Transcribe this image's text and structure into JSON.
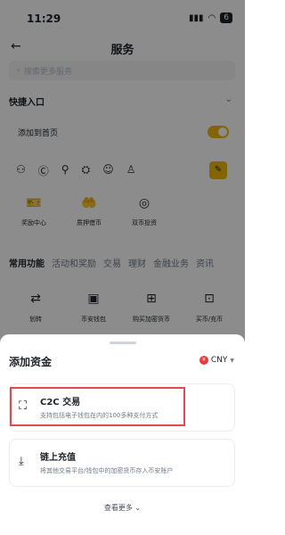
{
  "status_bar": {
    "time": "11:29",
    "battery": "6"
  },
  "nav": {
    "back_glyph": "←",
    "title": "服务"
  },
  "search": {
    "placeholder": "搜索更多服务"
  },
  "quick": {
    "title": "快捷入口",
    "add_home": "添加到首页",
    "toggle_on": true
  },
  "shortcuts": [
    {
      "icon": "award-icon",
      "label": "奖励中心"
    },
    {
      "icon": "loan-icon",
      "label": "质押借币"
    },
    {
      "icon": "dual-icon",
      "label": "双币投资"
    }
  ],
  "tabs": [
    "常用功能",
    "活动和奖励",
    "交易",
    "理财",
    "金融业务",
    "资讯"
  ],
  "functions": [
    {
      "icon": "transfer-icon",
      "label": "划转"
    },
    {
      "icon": "wallet-icon",
      "label": "币安钱包"
    },
    {
      "icon": "gift-icon",
      "label": "购买加密货币"
    },
    {
      "icon": "trade-icon",
      "label": "买币/充币"
    }
  ],
  "sheet": {
    "title": "添加资金",
    "currency": "CNY",
    "currency_symbol": "¥",
    "options": [
      {
        "title": "C2C 交易",
        "desc": "支持包括电子钱包在内的100多种支付方式"
      },
      {
        "title": "链上充值",
        "desc": "将其他交易平台/钱包中的加密货币存入币安账户"
      }
    ],
    "more": "查看更多"
  }
}
